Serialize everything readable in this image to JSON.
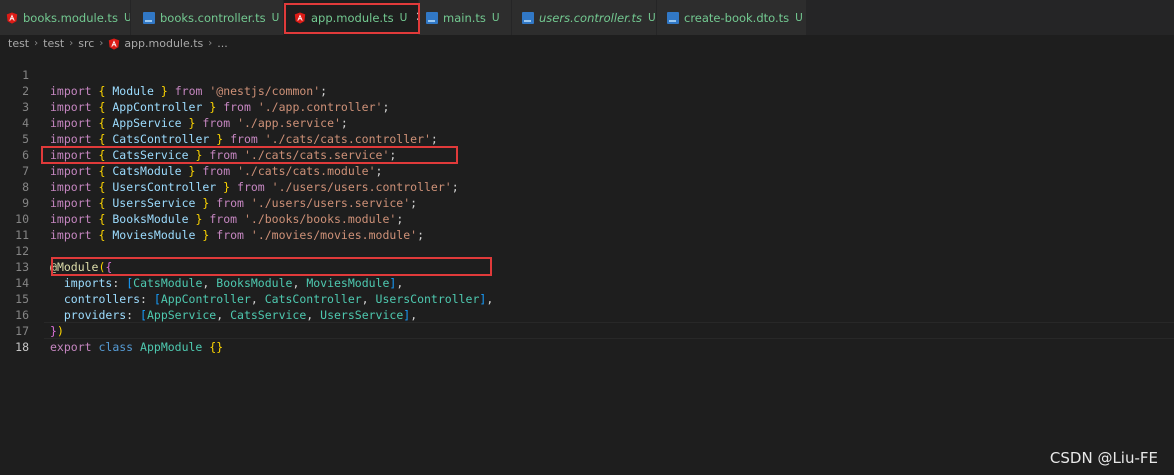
{
  "tabs": [
    {
      "label": "books.module.ts",
      "status": "U",
      "icon": "angular-icon",
      "italic": false,
      "active": false
    },
    {
      "label": "books.controller.ts",
      "status": "U",
      "icon": "typescript-icon",
      "italic": false,
      "active": false
    },
    {
      "label": "app.module.ts",
      "status": "U",
      "icon": "angular-icon",
      "italic": false,
      "active": true,
      "close": "✕"
    },
    {
      "label": "main.ts",
      "status": "U",
      "icon": "typescript-icon",
      "italic": false,
      "active": false
    },
    {
      "label": "users.controller.ts",
      "status": "U",
      "icon": "typescript-icon",
      "italic": true,
      "active": false
    },
    {
      "label": "create-book.dto.ts",
      "status": "U",
      "icon": "typescript-icon",
      "italic": false,
      "active": false
    }
  ],
  "breadcrumb": [
    "test",
    "test",
    "src",
    "app.module.ts",
    "..."
  ],
  "colors": {
    "accent_box": "#e03a3a",
    "modified_green": "#73c991"
  },
  "line_numbers": [
    "1",
    "2",
    "3",
    "4",
    "5",
    "6",
    "7",
    "8",
    "9",
    "10",
    "11",
    "12",
    "13",
    "14",
    "15",
    "16",
    "17",
    "18"
  ],
  "code": {
    "l1": [
      "import",
      "{",
      "Module",
      "}",
      "from",
      "'@nestjs/common'",
      ";"
    ],
    "l2": [
      "import",
      "{",
      "AppController",
      "}",
      "from",
      "'./app.controller'",
      ";"
    ],
    "l3": [
      "import",
      "{",
      "AppService",
      "}",
      "from",
      "'./app.service'",
      ";"
    ],
    "l4": [
      "import",
      "{",
      "CatsController",
      "}",
      "from",
      "'./cats/cats.controller'",
      ";"
    ],
    "l5": [
      "import",
      "{",
      "CatsService",
      "}",
      "from",
      "'./cats/cats.service'",
      ";"
    ],
    "l6": [
      "import",
      "{",
      "CatsModule",
      "}",
      "from",
      "'./cats/cats.module'",
      ";"
    ],
    "l7": [
      "import",
      "{",
      "UsersController",
      "}",
      "from",
      "'./users/users.controller'",
      ";"
    ],
    "l8": [
      "import",
      "{",
      "UsersService",
      "}",
      "from",
      "'./users/users.service'",
      ";"
    ],
    "l9": [
      "import",
      "{",
      "BooksModule",
      "}",
      "from",
      "'./books/books.module'",
      ";"
    ],
    "l10": [
      "import",
      "{",
      "MoviesModule",
      "}",
      "from",
      "'./movies/movies.module'",
      ";"
    ],
    "l12": [
      "@",
      "Module",
      "(",
      "{"
    ],
    "l13": [
      "imports",
      ":",
      "[",
      "CatsModule",
      ",",
      "BooksModule",
      ",",
      "MoviesModule",
      "]",
      ","
    ],
    "l14": [
      "controllers",
      ":",
      "[",
      "AppController",
      ",",
      "CatsController",
      ",",
      "UsersController",
      "]",
      ","
    ],
    "l15": [
      "providers",
      ":",
      "[",
      "AppService",
      ",",
      "CatsService",
      ",",
      "UsersService",
      "]",
      ","
    ],
    "l16": [
      "}",
      ")"
    ],
    "l17": [
      "export",
      "class",
      "AppModule",
      "{}"
    ]
  },
  "watermark": "CSDN @Liu-FE"
}
